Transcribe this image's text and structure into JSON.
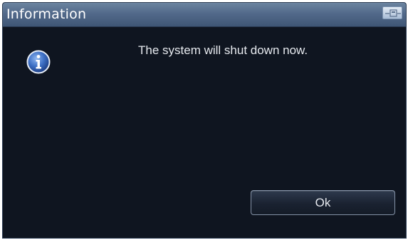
{
  "dialog": {
    "title": "Information",
    "message": "The system will shut down now.",
    "ok_label": "Ok",
    "icon": "info-icon",
    "restore_icon": "restore-window-icon"
  },
  "colors": {
    "background": "#0f1520",
    "titlebar": "#52698a",
    "text": "#e6e9ee",
    "info_icon": "#3d6fc4"
  }
}
